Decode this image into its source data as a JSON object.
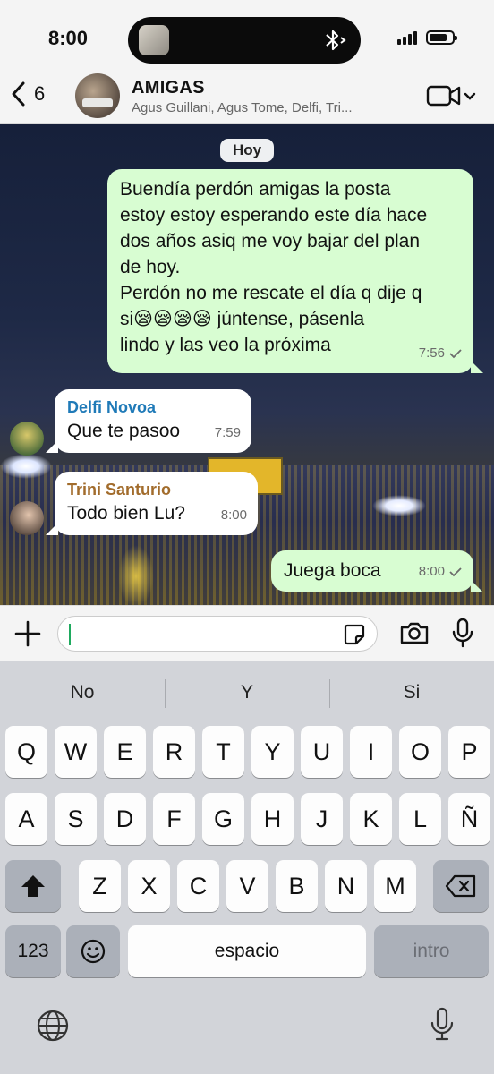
{
  "status_bar": {
    "time": "8:00"
  },
  "header": {
    "back_count": "6",
    "group_name": "AMIGAS",
    "members": "Agus Guillani, Agus Tome, Delfi, Tri..."
  },
  "chat": {
    "date_label": "Hoy",
    "messages": [
      {
        "direction": "outgoing",
        "lines": [
          "Buendía perdón amigas la posta",
          "estoy estoy esperando este día hace",
          "dos años asiq me voy bajar del plan",
          "de hoy.",
          "Perdón no me rescate el día q dije q",
          "si😪😪😪😪 júntense, pásenla",
          "lindo y las veo la próxima"
        ],
        "time": "7:56",
        "status": "sent"
      },
      {
        "direction": "incoming",
        "sender": "Delfi Novoa",
        "sender_color": "#1f7ab8",
        "text": "Que te pasoo",
        "time": "7:59"
      },
      {
        "direction": "incoming",
        "sender": "Trini Santurio",
        "sender_color": "#a26c2c",
        "text": "Todo bien Lu?",
        "time": "8:00"
      },
      {
        "direction": "outgoing",
        "text": "Juega boca",
        "time": "8:00",
        "status": "sent"
      }
    ]
  },
  "input": {
    "value": "",
    "placeholder": ""
  },
  "keyboard": {
    "suggestions": [
      "No",
      "Y",
      "Si"
    ],
    "row1": [
      "Q",
      "W",
      "E",
      "R",
      "T",
      "Y",
      "U",
      "I",
      "O",
      "P"
    ],
    "row2": [
      "A",
      "S",
      "D",
      "F",
      "G",
      "H",
      "J",
      "K",
      "L",
      "Ñ"
    ],
    "row3": [
      "Z",
      "X",
      "C",
      "V",
      "B",
      "N",
      "M"
    ],
    "numbers_label": "123",
    "space_label": "espacio",
    "return_label": "intro"
  },
  "colors": {
    "outgoing_bubble": "#d8fdd2",
    "incoming_bubble": "#ffffff",
    "accent_green": "#1faa5f"
  }
}
